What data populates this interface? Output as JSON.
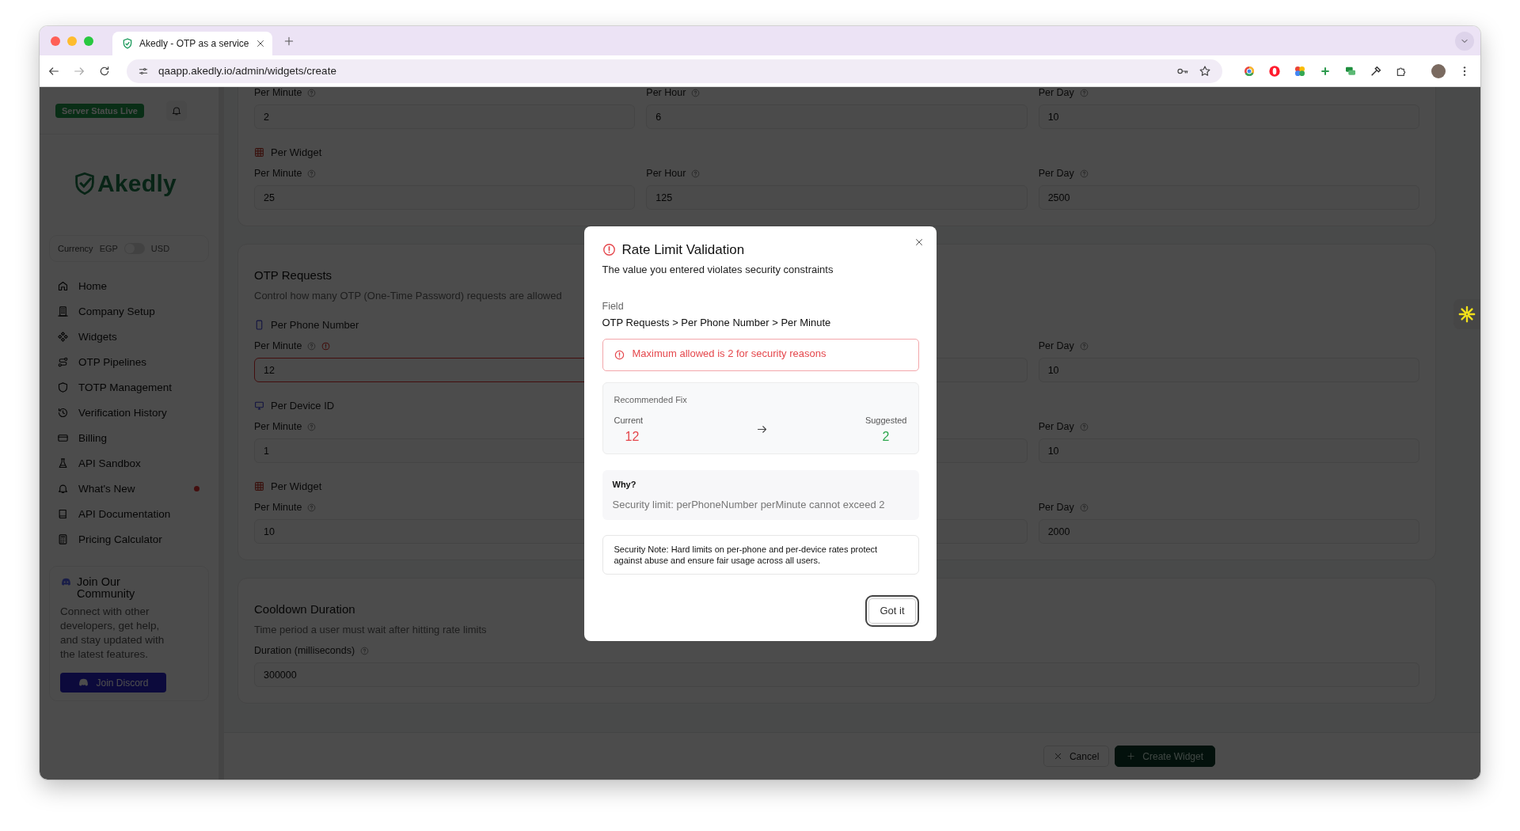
{
  "browser": {
    "tab_title": "Akedly - OTP as a service",
    "url": "qaapp.akedly.io/admin/widgets/create"
  },
  "sidebar": {
    "status_badge": "Server Status Live",
    "logo": "Akedly",
    "currency": {
      "label": "Currency",
      "left": "EGP",
      "right": "USD",
      "on": false
    },
    "items": [
      {
        "label": "Home",
        "new": false
      },
      {
        "label": "Company Setup",
        "new": false
      },
      {
        "label": "Widgets",
        "new": false
      },
      {
        "label": "OTP Pipelines",
        "new": false
      },
      {
        "label": "TOTP Management",
        "new": false
      },
      {
        "label": "Verification History",
        "new": false
      },
      {
        "label": "Billing",
        "new": false
      },
      {
        "label": "API Sandbox",
        "new": false
      },
      {
        "label": "What's New",
        "new": true
      },
      {
        "label": "API Documentation",
        "new": false
      },
      {
        "label": "Pricing Calculator",
        "new": false
      }
    ],
    "community": {
      "title": "Join Our Community",
      "text": "Connect with other developers, get help, and stay updated with the latest features.",
      "button": "Join Discord"
    }
  },
  "cards": [
    {
      "groups": [
        {
          "fields": [
            {
              "kind": "number",
              "label": "Per Minute",
              "value": "2",
              "error": false
            },
            {
              "kind": "number",
              "label": "Per Hour",
              "value": "6",
              "error": false
            },
            {
              "kind": "number",
              "label": "Per Day",
              "value": "10",
              "error": false
            }
          ]
        },
        {
          "kind": "widget",
          "title": "Per Widget",
          "fields": [
            {
              "kind": "number",
              "label": "Per Minute",
              "value": "25",
              "error": false
            },
            {
              "kind": "number",
              "label": "Per Hour",
              "value": "125",
              "error": false
            },
            {
              "kind": "number",
              "label": "Per Day",
              "value": "2500",
              "error": false
            }
          ]
        }
      ]
    },
    {
      "title": "OTP Requests",
      "description": "Control how many OTP (One-Time Password) requests are allowed",
      "groups": [
        {
          "kind": "phone",
          "title": "Per Phone Number",
          "fields": [
            {
              "kind": "number",
              "label": "Per Minute",
              "value": "12",
              "error": true
            },
            {
              "kind": "covered"
            },
            {
              "kind": "number",
              "label": "Per Day",
              "value": "10",
              "error": false
            }
          ]
        },
        {
          "kind": "device",
          "title": "Per Device ID",
          "fields": [
            {
              "kind": "number",
              "label": "Per Minute",
              "value": "1",
              "error": false
            },
            {
              "kind": "covered"
            },
            {
              "kind": "number",
              "label": "Per Day",
              "value": "10",
              "error": false
            }
          ]
        },
        {
          "kind": "widget",
          "title": "Per Widget",
          "fields": [
            {
              "kind": "number",
              "label": "Per Minute",
              "value": "10",
              "error": false
            },
            {
              "kind": "covered"
            },
            {
              "kind": "number",
              "label": "Per Day",
              "value": "2000",
              "error": false
            }
          ]
        }
      ]
    },
    {
      "title": "Cooldown Duration",
      "description": "Time period a user must wait after hitting rate limits",
      "groups": [
        {
          "fields": [
            {
              "kind": "number",
              "label": "Duration (milliseconds)",
              "value": "300000",
              "error": false
            }
          ]
        }
      ]
    }
  ],
  "footer": {
    "cancel": "Cancel",
    "create": "Create Widget"
  },
  "modal": {
    "title": "Rate Limit Validation",
    "subtitle": "The value you entered violates security constraints",
    "field_label": "Field",
    "field_path": "OTP Requests > Per Phone Number > Per Minute",
    "error": "Maximum allowed is 2 for security reasons",
    "fix": {
      "title": "Recommended Fix",
      "current_label": "Current",
      "current_value": "12",
      "suggested_label": "Suggested",
      "suggested_value": "2"
    },
    "why": {
      "title": "Why?",
      "text": "Security limit: perPhoneNumber perMinute cannot exceed 2"
    },
    "note": "Security Note: Hard limits on per-phone and per-device rates protect against abuse and ensure fair usage across all users.",
    "button": "Got it"
  }
}
